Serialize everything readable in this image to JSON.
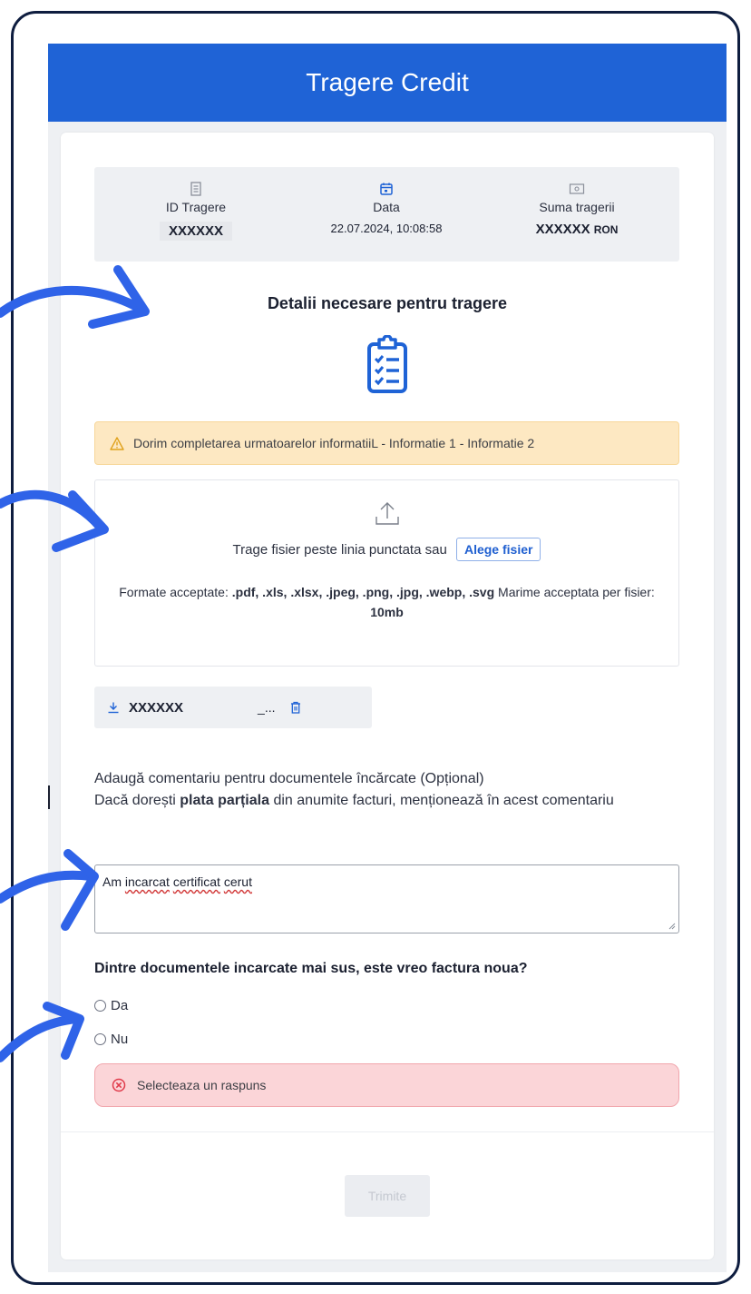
{
  "header": {
    "title": "Tragere Credit"
  },
  "summary": {
    "id_label": "ID Tragere",
    "id_value": "XXXXXX",
    "date_label": "Data",
    "date_value": "22.07.2024, 10:08:58",
    "amount_label": "Suma tragerii",
    "amount_value": "XXXXXX",
    "amount_currency": "RON"
  },
  "details": {
    "title": "Detalii necesare pentru tragere"
  },
  "warning": {
    "text": "Dorim completarea urmatoarelor informatiiL - Informatie 1 - Informatie 2"
  },
  "upload": {
    "drag_text": "Trage fisier peste linia punctata sau",
    "choose_label": "Alege fisier",
    "formats_label": "Formate acceptate:",
    "formats_value": ".pdf, .xls, .xlsx, .jpeg, .png, .jpg, .webp, .svg",
    "size_label": "Marime acceptata per fisier:",
    "size_value": "10mb"
  },
  "file": {
    "name": "XXXXXX",
    "ext": "_..."
  },
  "comment": {
    "label_line1": "Adaugă comentariu pentru documentele încărcate (Opțional)",
    "label_line2_pre": "Dacă dorești",
    "label_line2_bold": "plata parțiala",
    "label_line2_post": "din anumite facturi, menționează în acest comentariu",
    "value_word1": "Am",
    "value_word2": "incarcat",
    "value_word3": "certificat",
    "value_word4": "cerut"
  },
  "question": {
    "text": "Dintre documentele incarcate mai sus, este vreo factura noua?",
    "options": [
      "Da",
      "Nu"
    ],
    "error": "Selecteaza un raspuns"
  },
  "footer": {
    "submit_label": "Trimite"
  },
  "colors": {
    "brand": "#1f63d6",
    "arrow": "#2f63e8",
    "warning_bg": "#fde8c2",
    "error_bg": "#fbd5d8"
  }
}
